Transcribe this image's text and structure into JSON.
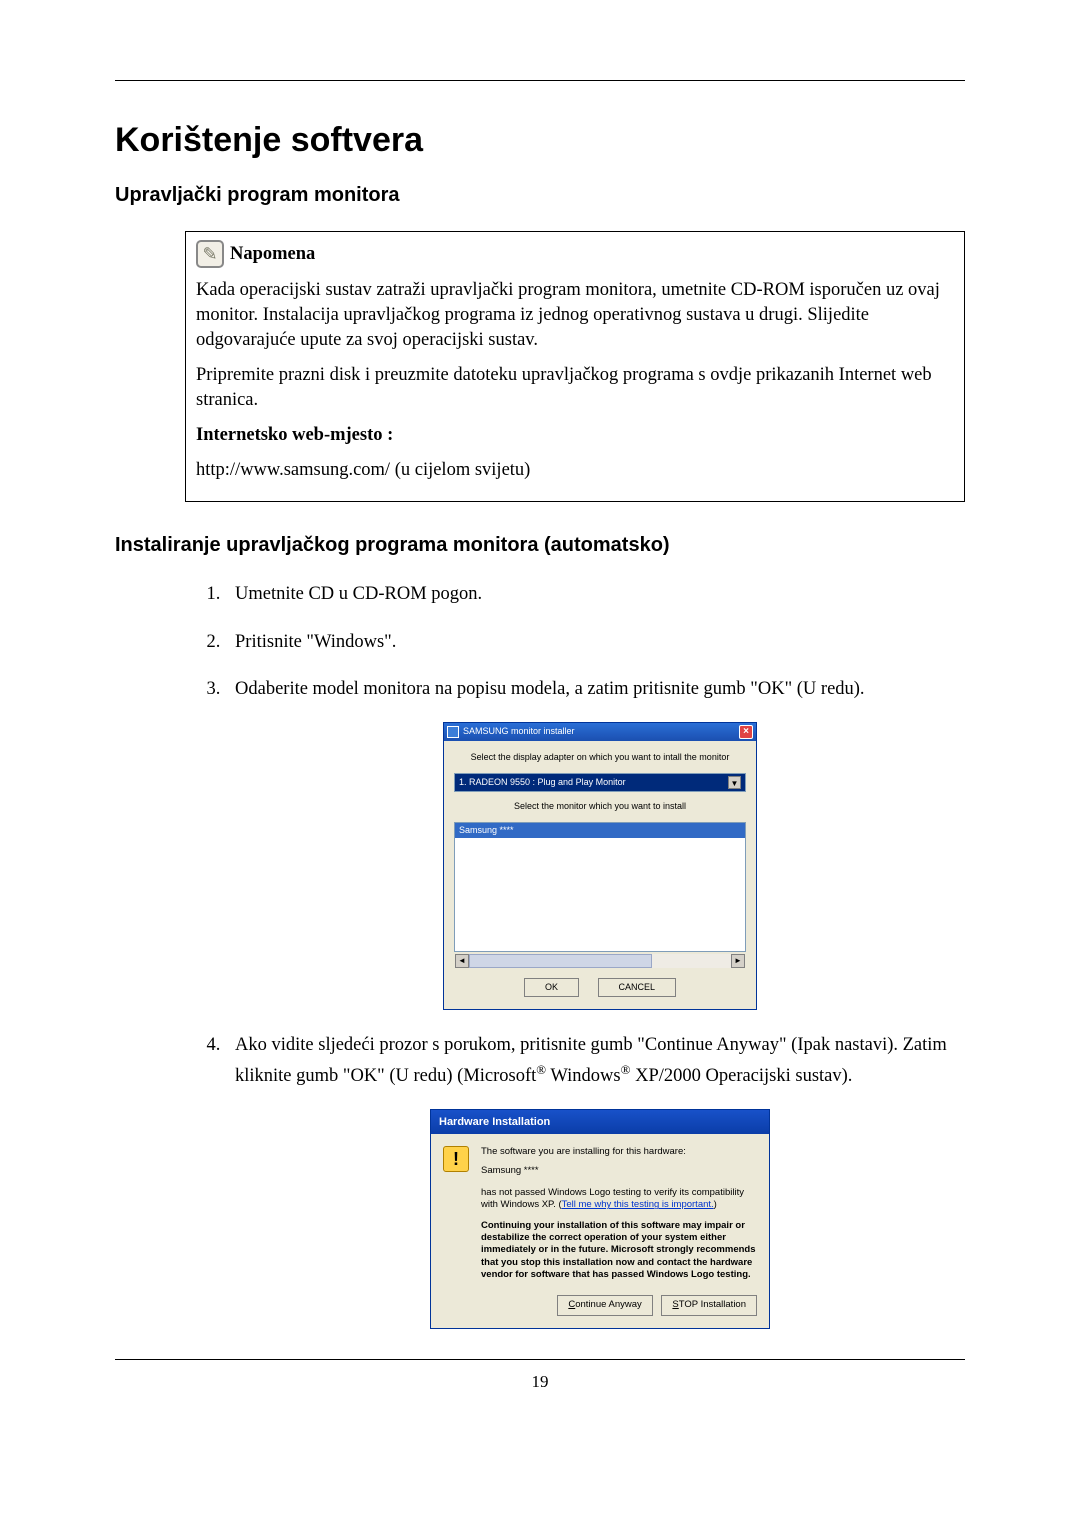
{
  "h1": "Korištenje softvera",
  "h2a": "Upravljački program monitora",
  "note": {
    "title": "Napomena",
    "p1": "Kada operacijski sustav zatraži upravljački program monitora, umetnite CD-ROM isporučen uz ovaj monitor. Instalacija upravljačkog programa iz jednog operativnog sustava u drugi. Slijedite odgovarajuće upute za svoj operacijski sustav.",
    "p2": "Pripremite prazni disk i preuzmite datoteku upravljačkog programa s ovdje prikazanih Internet web stranica.",
    "p3_bold": "Internetsko web-mjesto :",
    "p4": "http://www.samsung.com/ (u cijelom svijetu)"
  },
  "h2b": "Instaliranje upravljačkog programa monitora (automatsko)",
  "steps": {
    "s1": "Umetnite CD u CD-ROM pogon.",
    "s2": "Pritisnite \"Windows\".",
    "s3": "Odaberite model monitora na popisu modela, a zatim pritisnite gumb \"OK\" (U redu).",
    "s4a": "Ako vidite sljedeći prozor s porukom, pritisnite gumb \"Continue Anyway\" (Ipak nastavi). Zatim kliknite gumb \"OK\" (U redu) (Microsoft",
    "s4b": " Windows",
    "s4c": " XP/2000 Operacijski sustav)."
  },
  "dialog1": {
    "title": "SAMSUNG monitor installer",
    "label1": "Select the display adapter on which you want to intall the monitor",
    "select_value": "1. RADEON 9550 : Plug and Play Monitor",
    "label2": "Select the monitor which you want to install",
    "list_item": "Samsung ****",
    "ok": "OK",
    "cancel": "CANCEL"
  },
  "dialog2": {
    "title": "Hardware Installation",
    "hw": "The software you are installing for this hardware:",
    "name": "Samsung ****",
    "logo1": "has not passed Windows Logo testing to verify its compatibility with Windows XP. (",
    "logo_link": "Tell me why this testing is important.",
    "logo2": ")",
    "warn": "Continuing your installation of this software may impair or destabilize the correct operation of your system either immediately or in the future. Microsoft strongly recommends that you stop this installation now and contact the hardware vendor for software that has passed Windows Logo testing.",
    "cont_u": "C",
    "cont_rest": "ontinue Anyway",
    "stop_u": "S",
    "stop_rest": "TOP Installation"
  },
  "page_num": "19",
  "reg": "®"
}
